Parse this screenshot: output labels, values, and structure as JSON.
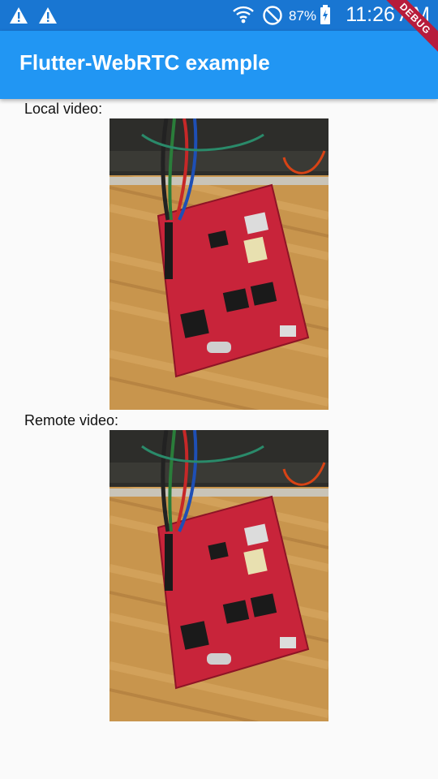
{
  "status_bar": {
    "battery_percent": "87%",
    "time": "11:26 AM",
    "icons": [
      "warning-icon",
      "warning-icon",
      "wifi-icon",
      "do-not-disturb-icon",
      "battery-icon"
    ]
  },
  "debug_banner": "DEBUG",
  "app_bar": {
    "title": "Flutter-WebRTC example"
  },
  "local": {
    "label": "Local video:"
  },
  "remote": {
    "label": "Remote video:"
  },
  "colors": {
    "status_bar": "#1976d2",
    "app_bar": "#2196f3",
    "background": "#fafafa",
    "debug_banner": "#b71c3c"
  }
}
